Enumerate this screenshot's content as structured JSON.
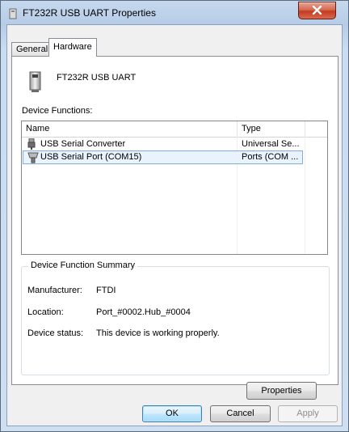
{
  "window": {
    "title": "FT232R USB UART Properties",
    "close_label": "X"
  },
  "tabs": [
    {
      "label": "General"
    },
    {
      "label": "Hardware"
    }
  ],
  "device": {
    "name": "FT232R USB UART"
  },
  "device_functions": {
    "label": "Device Functions:",
    "columns": [
      "Name",
      "Type"
    ],
    "rows": [
      {
        "name": "USB Serial Converter",
        "type": "Universal Se...",
        "icon": "usb-plug-icon"
      },
      {
        "name": "USB Serial Port (COM15)",
        "type": "Ports (COM ...",
        "icon": "serial-port-icon"
      }
    ]
  },
  "summary": {
    "title": "Device Function Summary",
    "manufacturer_label": "Manufacturer:",
    "manufacturer_value": "FTDI",
    "location_label": "Location:",
    "location_value": "Port_#0002.Hub_#0004",
    "status_label": "Device status:",
    "status_value": "This device is working properly.",
    "properties_button": "Properties"
  },
  "buttons": {
    "ok": "OK",
    "cancel": "Cancel",
    "apply": "Apply"
  }
}
